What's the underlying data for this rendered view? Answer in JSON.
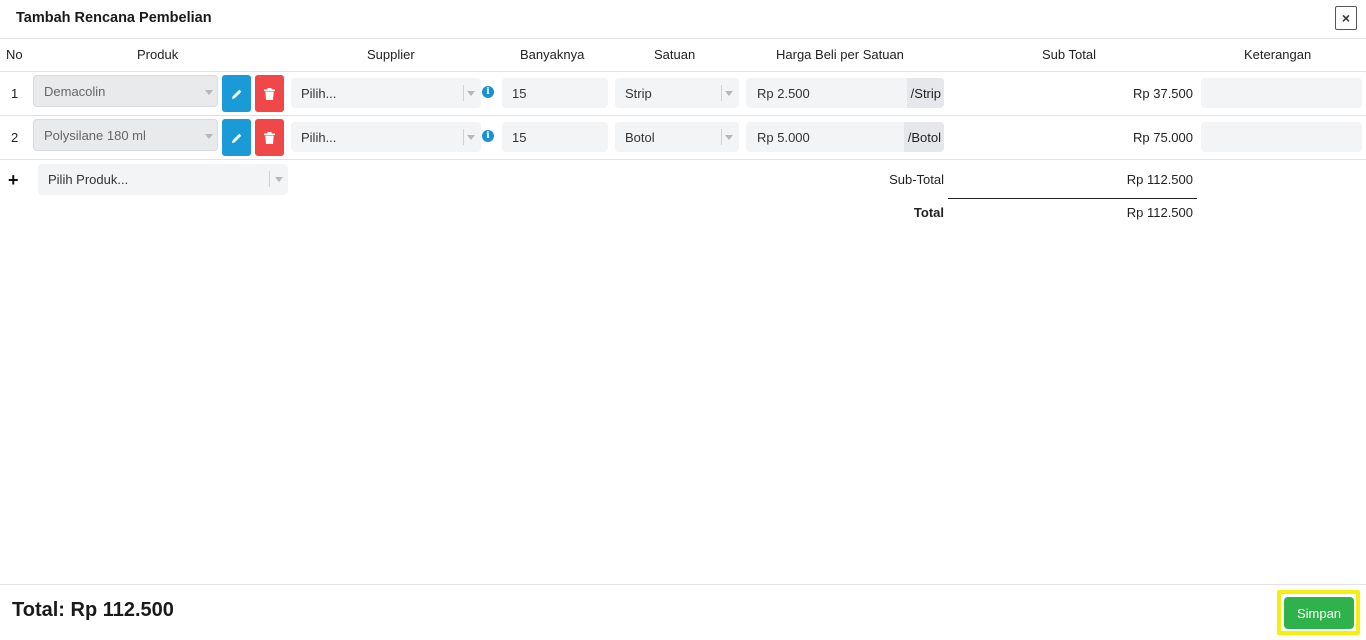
{
  "modal": {
    "title": "Tambah Rencana Pembelian",
    "close_label": "×"
  },
  "columns": {
    "no": "No",
    "produk": "Produk",
    "supplier": "Supplier",
    "banyaknya": "Banyaknya",
    "satuan": "Satuan",
    "harga": "Harga Beli per Satuan",
    "subtotal": "Sub Total",
    "keterangan": "Keterangan"
  },
  "rows": [
    {
      "no": "1",
      "product": "Demacolin",
      "supplier": "Pilih...",
      "quantity": "15",
      "unit": "Strip",
      "price": "Rp 2.500",
      "price_unit": "/Strip",
      "subtotal": "Rp 37.500",
      "note": ""
    },
    {
      "no": "2",
      "product": "Polysilane 180 ml",
      "supplier": "Pilih...",
      "quantity": "15",
      "unit": "Botol",
      "price": "Rp 5.000",
      "price_unit": "/Botol",
      "subtotal": "Rp 75.000",
      "note": ""
    }
  ],
  "add_product": {
    "placeholder": "Pilih Produk...",
    "plus_label": "+"
  },
  "summary": {
    "subtotal_label": "Sub-Total",
    "subtotal_value": "Rp 112.500",
    "total_label": "Total",
    "total_value": "Rp 112.500"
  },
  "footer": {
    "total_text": "Total: Rp 112.500",
    "save_label": "Simpan"
  },
  "colors": {
    "edit_button": "#1a9ad6",
    "delete_button": "#f04848",
    "save_button": "#2fb14c",
    "save_highlight": "#f5ef0f",
    "info_icon": "#1a8fd1"
  },
  "icons": {
    "edit": "pencil-icon",
    "delete": "trash-icon",
    "info": "info-icon",
    "add": "plus-icon",
    "close": "close-icon",
    "dropdown": "chevron-down-icon"
  }
}
